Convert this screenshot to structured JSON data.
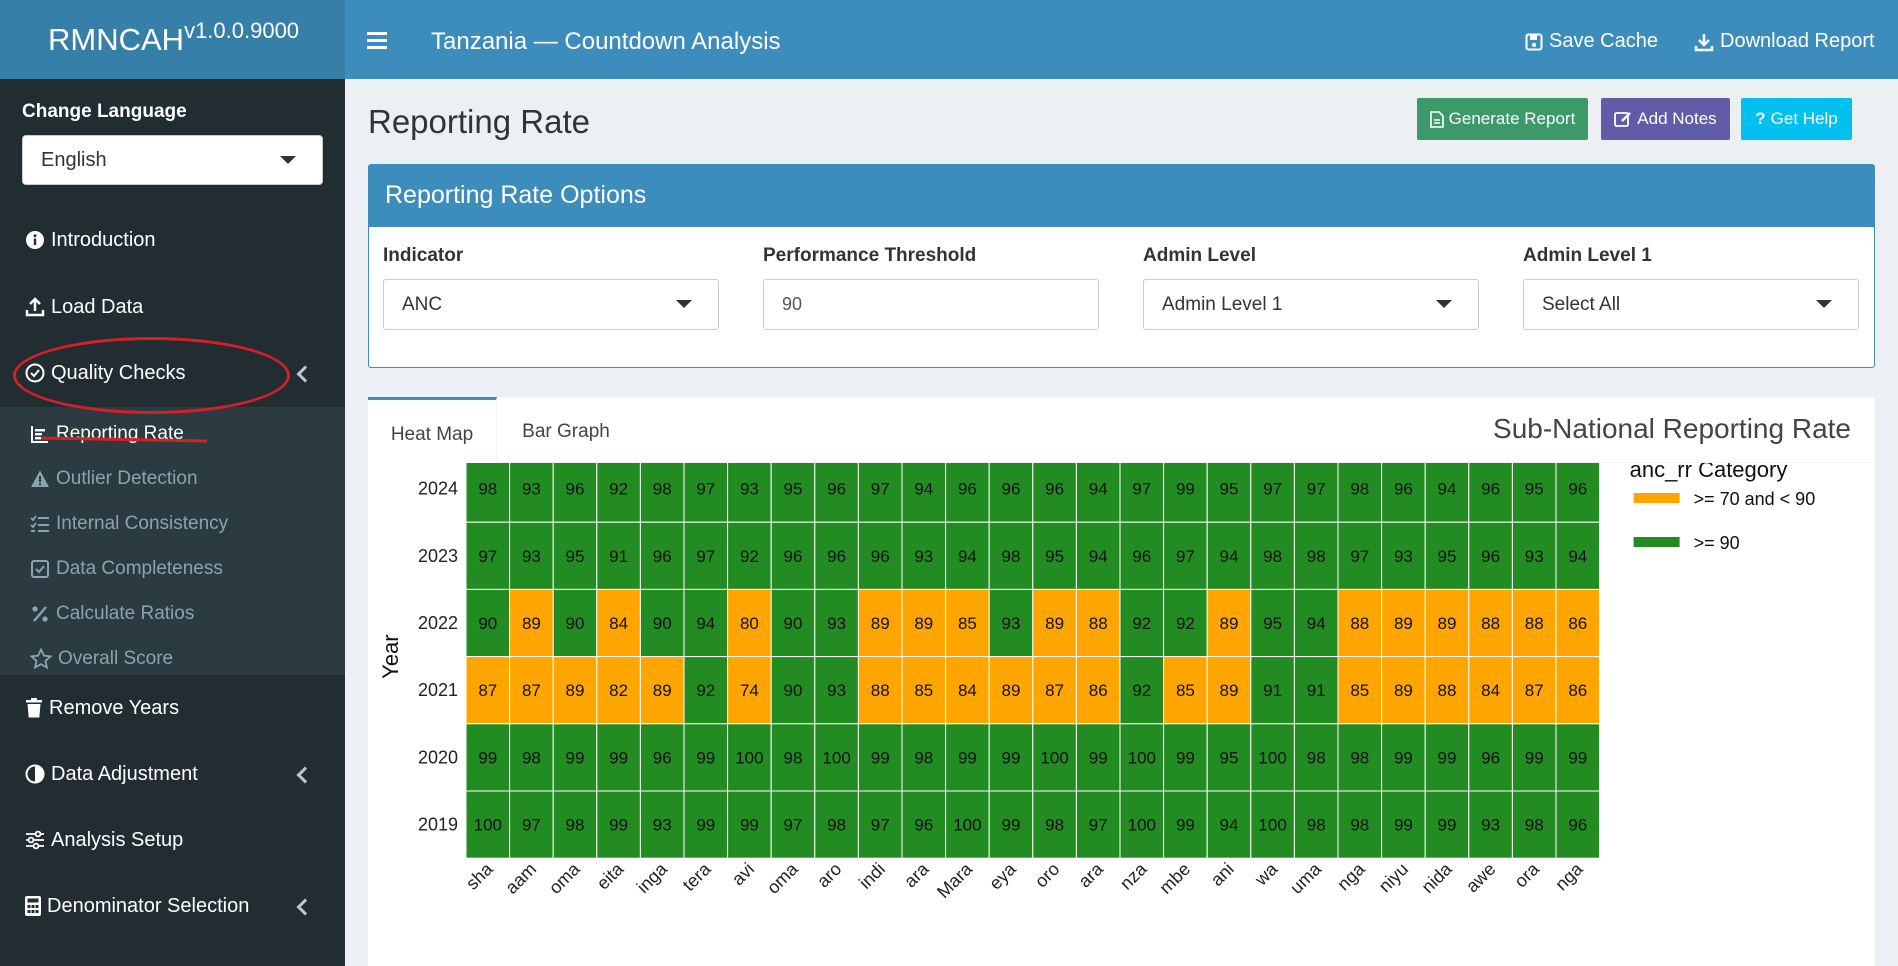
{
  "brand": {
    "name": "RMNCAH",
    "version": "v1.0.0.9000"
  },
  "header": {
    "title": "Tanzania — Countdown Analysis",
    "save_cache": "Save Cache",
    "download_report": "Download Report"
  },
  "sidebar": {
    "language_label": "Change Language",
    "language_value": "English",
    "items": [
      {
        "label": "Introduction",
        "icon": "info-circle-icon"
      },
      {
        "label": "Load Data",
        "icon": "upload-icon"
      },
      {
        "label": "Quality Checks",
        "icon": "check-circle-icon"
      },
      {
        "label": "Remove Years",
        "icon": "trash-icon"
      },
      {
        "label": "Data Adjustment",
        "icon": "adjust-icon"
      },
      {
        "label": "Analysis Setup",
        "icon": "sliders-icon"
      },
      {
        "label": "Denominator Selection",
        "icon": "calculator-icon"
      }
    ],
    "subitems": [
      {
        "label": "Reporting Rate",
        "icon": "bar-chart-icon"
      },
      {
        "label": "Outlier Detection",
        "icon": "warning-icon"
      },
      {
        "label": "Internal Consistency",
        "icon": "list-check-icon"
      },
      {
        "label": "Data Completeness",
        "icon": "checkbox-icon"
      },
      {
        "label": "Calculate Ratios",
        "icon": "percent-icon"
      },
      {
        "label": "Overall Score",
        "icon": "star-icon"
      }
    ]
  },
  "page": {
    "title": "Reporting Rate",
    "generate_report": "Generate Report",
    "add_notes": "Add Notes",
    "get_help": "Get Help"
  },
  "options": {
    "title": "Reporting Rate Options",
    "indicator_label": "Indicator",
    "indicator_value": "ANC",
    "threshold_label": "Performance Threshold",
    "threshold_value": "90",
    "admin_level_label": "Admin Level",
    "admin_level_value": "Admin Level 1",
    "admin_level1_label": "Admin Level 1",
    "admin_level1_value": "Select All"
  },
  "tabs": {
    "heat_map": "Heat Map",
    "bar_graph": "Bar Graph"
  },
  "colors": {
    "high": "#228b22",
    "mid": "#ffa500",
    "brand": "#3c8dbc",
    "sidebar": "#222d32",
    "annotation": "#d81f26"
  },
  "chart_data": {
    "type": "heatmap",
    "title": "Sub-National Reporting Rate",
    "ylabel": "Year",
    "years": [
      "2024",
      "2023",
      "2022",
      "2021",
      "2020",
      "2019"
    ],
    "regions": [
      "sha",
      "aam",
      "oma",
      "eita",
      "inga",
      "tera",
      "avi",
      "oma",
      "aro",
      "indi",
      "ara",
      "Mara",
      "eya",
      "oro",
      "ara",
      "nza",
      "mbe",
      "ani",
      "wa",
      "uma",
      "nga",
      "niyu",
      "nida",
      "awe",
      "ora",
      "nga"
    ],
    "values": [
      [
        98,
        93,
        96,
        92,
        98,
        97,
        93,
        95,
        96,
        97,
        94,
        96,
        96,
        96,
        94,
        97,
        99,
        95,
        97,
        97,
        98,
        96,
        94,
        96,
        95,
        96
      ],
      [
        97,
        93,
        95,
        91,
        96,
        97,
        92,
        96,
        96,
        96,
        93,
        94,
        98,
        95,
        94,
        96,
        97,
        94,
        98,
        98,
        97,
        93,
        95,
        96,
        93,
        94
      ],
      [
        90,
        89,
        90,
        84,
        90,
        94,
        80,
        90,
        93,
        89,
        89,
        85,
        93,
        89,
        88,
        92,
        92,
        89,
        95,
        94,
        88,
        89,
        89,
        88,
        88,
        86
      ],
      [
        87,
        87,
        89,
        82,
        89,
        92,
        74,
        90,
        93,
        88,
        85,
        84,
        89,
        87,
        86,
        92,
        85,
        89,
        91,
        91,
        85,
        89,
        88,
        84,
        87,
        86
      ],
      [
        99,
        98,
        99,
        99,
        96,
        99,
        100,
        98,
        100,
        99,
        98,
        99,
        99,
        100,
        99,
        100,
        99,
        95,
        100,
        98,
        98,
        99,
        99,
        96,
        99,
        99
      ],
      [
        100,
        97,
        98,
        99,
        93,
        99,
        99,
        97,
        98,
        97,
        96,
        100,
        99,
        98,
        97,
        100,
        99,
        94,
        100,
        98,
        98,
        99,
        99,
        93,
        98,
        96
      ]
    ],
    "legend": {
      "title": "anc_rr Category",
      "mid": ">= 70 and < 90",
      "high": ">= 90"
    },
    "threshold": 90
  }
}
